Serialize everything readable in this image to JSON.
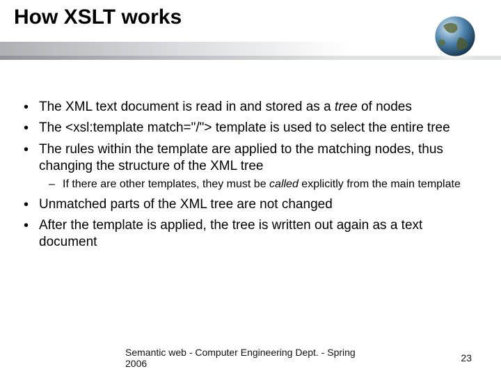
{
  "title": "How XSLT works",
  "bullets": {
    "b1_pre": "The XML text document is read in and stored as a ",
    "b1_em": "tree",
    "b1_post": " of nodes",
    "b2_pre": "The ",
    "b2_code": "<xsl:template match=\"/\">",
    "b2_post": " template is used to select the entire tree",
    "b3": "The rules within the template are applied to the matching nodes, thus changing the structure of the XML tree",
    "b3_sub_pre": "If there are other templates, they must be ",
    "b3_sub_em": "called",
    "b3_sub_post": " explicitly from the main template",
    "b4": "Unmatched parts of the XML tree are not changed",
    "b5": "After the template is applied, the tree is written out again as a text document"
  },
  "footer": {
    "center": "Semantic web - Computer Engineering Dept. - Spring 2006",
    "page": "23"
  }
}
